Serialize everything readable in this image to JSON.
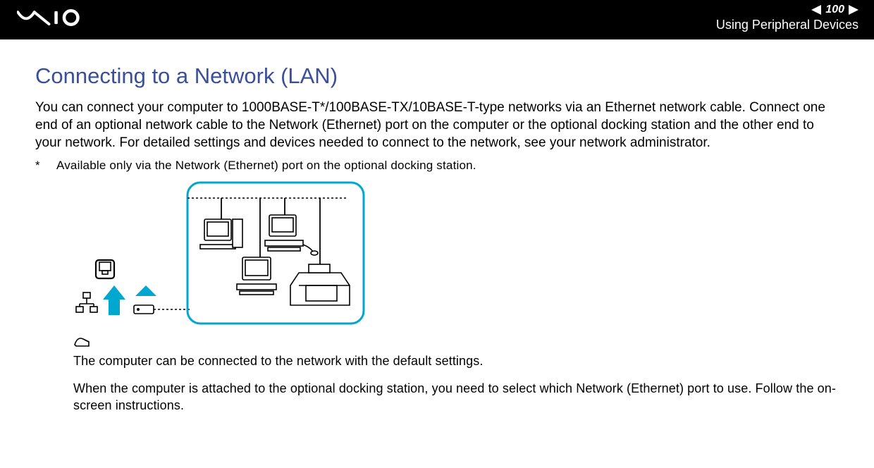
{
  "header": {
    "page_number": "100",
    "section": "Using Peripheral Devices"
  },
  "heading": "Connecting to a Network (LAN)",
  "body": "You can connect your computer to 1000BASE-T*/100BASE-TX/10BASE-T-type networks via an Ethernet network cable. Connect one end of an optional network cable to the Network (Ethernet) port on the computer or the optional docking station and the other end to your network. For detailed settings and devices needed to connect to the network, see your network administrator.",
  "footnote": {
    "marker": "*",
    "text": "Available only via the Network (Ethernet) port on the optional docking station."
  },
  "notes": {
    "n1": "The computer can be connected to the network with the default settings.",
    "n2": "When the computer is attached to the optional docking station, you need to select which Network (Ethernet) port to use. Follow the on-screen instructions."
  }
}
